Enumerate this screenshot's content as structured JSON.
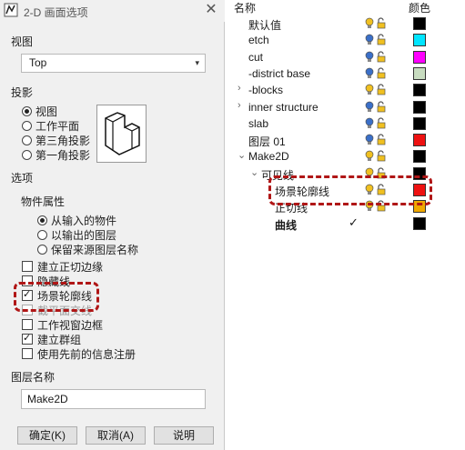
{
  "window": {
    "title": "2-D 画面选项",
    "close": "✕"
  },
  "view_section": {
    "label": "视图",
    "selected": "Top"
  },
  "projection": {
    "label": "投影",
    "options": [
      "视图",
      "工作平面",
      "第三角投影",
      "第一角投影"
    ],
    "selected_index": 0
  },
  "options_section": {
    "label": "选项",
    "props_label": "物件属性",
    "prop_options": [
      "从输入的物件",
      "以输出的图层",
      "保留来源图层名称"
    ],
    "prop_selected_index": 0,
    "checkboxes": [
      {
        "label": "建立正切边缘",
        "checked": false,
        "disabled": false
      },
      {
        "label": "隐藏线",
        "checked": false,
        "disabled": false
      },
      {
        "label": "场景轮廓线",
        "checked": true,
        "disabled": false
      },
      {
        "label": "截平面交线",
        "checked": false,
        "disabled": true
      },
      {
        "label": "工作视窗边框",
        "checked": false,
        "disabled": false
      },
      {
        "label": "建立群组",
        "checked": true,
        "disabled": false
      },
      {
        "label": "使用先前的信息注册",
        "checked": false,
        "disabled": false
      }
    ]
  },
  "layer_name": {
    "label": "图层名称",
    "value": "Make2D"
  },
  "buttons": {
    "ok": "确定(K)",
    "cancel": "取消(A)",
    "help": "说明"
  },
  "layers_panel": {
    "col_name": "名称",
    "col_color": "颜色",
    "rows": [
      {
        "name": "默认值",
        "color": "#000000",
        "bulb": "#f0c020"
      },
      {
        "name": "etch",
        "color": "#00e5ff",
        "bulb": "#3a6fc8"
      },
      {
        "name": "cut",
        "color": "#ff00ff",
        "bulb": "#3a6fc8"
      },
      {
        "name": "-district base",
        "color": "#c8dcc0",
        "bulb": "#3a6fc8"
      },
      {
        "name": "-blocks",
        "color": "#000000",
        "bulb": "#f0c020",
        "expander": "›"
      },
      {
        "name": "inner structure",
        "color": "#000000",
        "bulb": "#3a6fc8",
        "expander": "›"
      },
      {
        "name": "slab",
        "color": "#000000",
        "bulb": "#3a6fc8"
      },
      {
        "name": "图层 01",
        "color": "#ee1111",
        "bulb": "#3a6fc8"
      },
      {
        "name": "Make2D",
        "color": "#000000",
        "bulb": "#f0c020",
        "expander": "⌄"
      },
      {
        "name": "可见线",
        "color": "#000000",
        "bulb": "#f0c020",
        "expander": "⌄"
      },
      {
        "name": "场景轮廓线",
        "color": "#ee1111",
        "bulb": "#f0c020"
      },
      {
        "name": "正切线",
        "color": "#f0a800",
        "bulb": "#f0c020"
      },
      {
        "name": "曲线",
        "color": "#000000",
        "current": true
      }
    ]
  }
}
